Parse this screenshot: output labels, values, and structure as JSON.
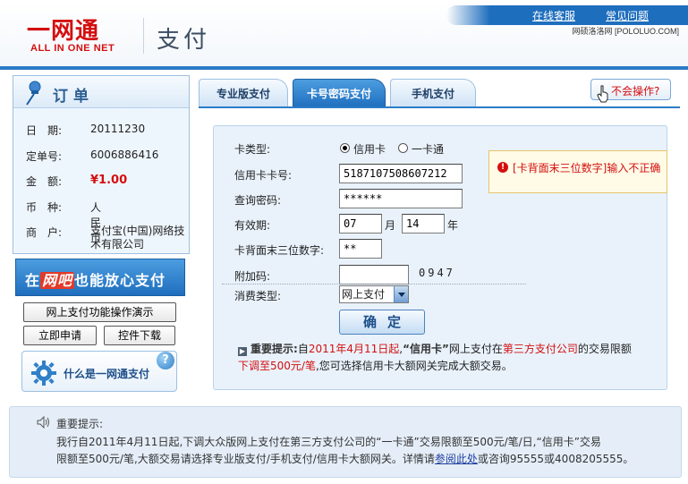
{
  "header": {
    "logo_cn": "一网通",
    "logo_en": "ALL IN ONE NET",
    "page_title": "支付",
    "nav": [
      "在线客服",
      "常见问题"
    ],
    "watermark": "网硕洛洛网 [POLOLUO.COM]"
  },
  "order": {
    "title": "订单",
    "rows": [
      {
        "label": "日　期:",
        "value": "20111230"
      },
      {
        "label": "定单号:",
        "value": "6006886416"
      },
      {
        "label": "金　额:",
        "value": "¥1.00"
      },
      {
        "label": "币　种:",
        "value": "人民币"
      },
      {
        "label": "商　户:",
        "value": "支付宝(中国)网络技术有限公司"
      }
    ]
  },
  "banner": {
    "pre": "在",
    "highlight": "网吧",
    "post": "也能放心支付"
  },
  "side_buttons": {
    "demo": "网上支付功能操作演示",
    "apply": "立即申请",
    "download": "控件下载"
  },
  "about": {
    "label": "什么是一网通支付",
    "bubble": "?"
  },
  "tabs": [
    "专业版支付",
    "卡号密码支付",
    "手机支付"
  ],
  "help": {
    "label": "不会操作?"
  },
  "form": {
    "card_type_label": "卡类型:",
    "card_type_options": [
      "信用卡",
      "一卡通"
    ],
    "card_number_label": "信用卡卡号:",
    "card_number_value": "5187107508607212",
    "password_label": "查询密码:",
    "password_value": "******",
    "expiry_label": "有效期:",
    "expiry_month": "07",
    "month_unit": "月",
    "expiry_year": "14",
    "year_unit": "年",
    "cvv_label": "卡背面末三位数字:",
    "cvv_value": "**",
    "extra_label": "附加码:",
    "extra_value": "",
    "captcha": "0947",
    "consume_label": "消费类型:",
    "consume_value": "网上支付",
    "confirm": "确定",
    "error": "[卡背面末三位数字]输入不正确"
  },
  "notice": {
    "title": "重要提示:",
    "p1": "自",
    "date": "2011年4月11日起",
    "p2": ",",
    "credit": "“信用卡”",
    "p3": "网上支付在",
    "third": "第三方支付公司",
    "p4": "的交易限额",
    "limit": "下调至500元/笔",
    "p5": ",您可选择信用卡大额网关完成大额交易。"
  },
  "bottom": {
    "title": "重要提示:",
    "line1": "我行自2011年4月11日起,下调大众版网上支付在第三方支付公司的“一卡通”交易限额至500元/笔/日,“信用卡”交易",
    "line2_pre": "限额至500元/笔,大额交易请选择专业版支付/手机支付/信用卡大额网关。详情请",
    "link": "参阅此处",
    "line2_post": "或咨询95555或4008205555。"
  },
  "colors": {
    "accent": "#1e6ebe",
    "error": "#d40f0f",
    "panel": "#e9f2fb"
  }
}
